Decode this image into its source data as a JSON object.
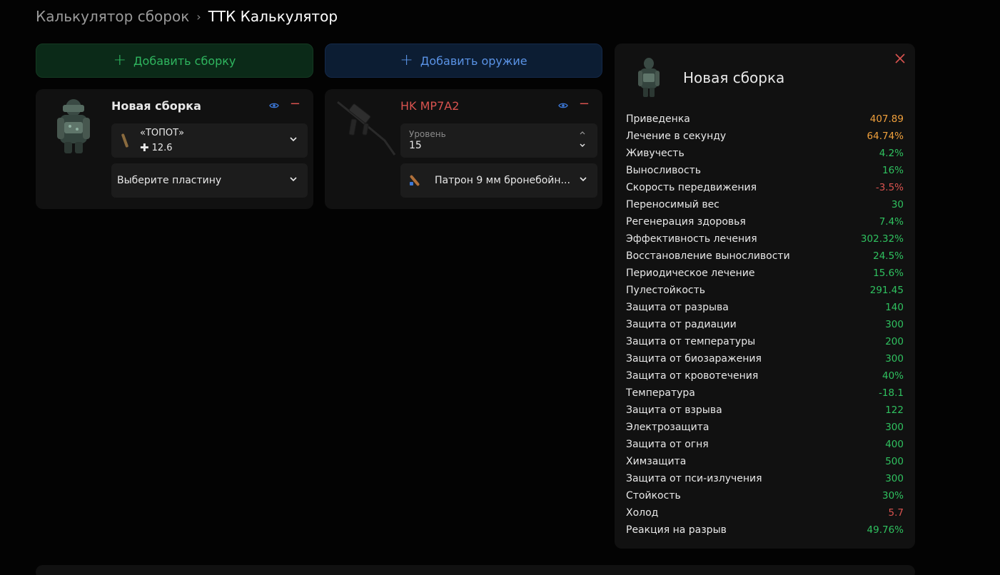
{
  "breadcrumb": {
    "parent": "Калькулятор сборок",
    "separator": "›",
    "current": "ТТК Калькулятор"
  },
  "buttons": {
    "add_build": "Добавить сборку",
    "add_weapon": "Добавить оружие",
    "plus": "+"
  },
  "build_card": {
    "title": "Новая сборка",
    "armor": {
      "name": "«ТОПОТ»",
      "value": "12.6",
      "value_icon": "cross-icon"
    },
    "plate_placeholder": "Выберите пластину",
    "minus": "−"
  },
  "weapon_card": {
    "title": "HK MP7A2",
    "level_label": "Уровень",
    "level_value": "15",
    "ammo": "Патрон 9 мм бронебойн...",
    "minus": "−"
  },
  "panel": {
    "title": "Новая сборка",
    "stats": [
      {
        "name": "Приведенка",
        "value": "407.89",
        "color": "#f0a03c"
      },
      {
        "name": "Лечение в секунду",
        "value": "64.74%",
        "color": "#f0a03c"
      },
      {
        "name": "Живучесть",
        "value": "4.2%",
        "color": "#2fc15f"
      },
      {
        "name": "Выносливость",
        "value": "16%",
        "color": "#2fc15f"
      },
      {
        "name": "Скорость передвижения",
        "value": "-3.5%",
        "color": "#d9534f"
      },
      {
        "name": "Переносимый вес",
        "value": "30",
        "color": "#2fc15f"
      },
      {
        "name": "Регенерация здоровья",
        "value": "7.4%",
        "color": "#2fc15f"
      },
      {
        "name": "Эффективность лечения",
        "value": "302.32%",
        "color": "#2fc15f"
      },
      {
        "name": "Восстановление выносливости",
        "value": "24.5%",
        "color": "#2fc15f"
      },
      {
        "name": "Периодическое лечение",
        "value": "15.6%",
        "color": "#2fc15f"
      },
      {
        "name": "Пулестойкость",
        "value": "291.45",
        "color": "#2fc15f"
      },
      {
        "name": "Защита от разрыва",
        "value": "140",
        "color": "#2fc15f"
      },
      {
        "name": "Защита от радиации",
        "value": "300",
        "color": "#2fc15f"
      },
      {
        "name": "Защита от температуры",
        "value": "200",
        "color": "#2fc15f"
      },
      {
        "name": "Защита от биозаражения",
        "value": "300",
        "color": "#2fc15f"
      },
      {
        "name": "Защита от кровотечения",
        "value": "40%",
        "color": "#2fc15f"
      },
      {
        "name": "Температура",
        "value": "-18.1",
        "color": "#2fc15f"
      },
      {
        "name": "Защита от взрыва",
        "value": "122",
        "color": "#2fc15f"
      },
      {
        "name": "Электрозащита",
        "value": "300",
        "color": "#2fc15f"
      },
      {
        "name": "Защита от огня",
        "value": "400",
        "color": "#2fc15f"
      },
      {
        "name": "Химзащита",
        "value": "500",
        "color": "#2fc15f"
      },
      {
        "name": "Защита от пси-излучения",
        "value": "300",
        "color": "#2fc15f"
      },
      {
        "name": "Стойкость",
        "value": "30%",
        "color": "#2fc15f"
      },
      {
        "name": "Холод",
        "value": "5.7",
        "color": "#d9534f"
      },
      {
        "name": "Реакция на разрыв",
        "value": "49.76%",
        "color": "#2fc15f"
      }
    ]
  }
}
